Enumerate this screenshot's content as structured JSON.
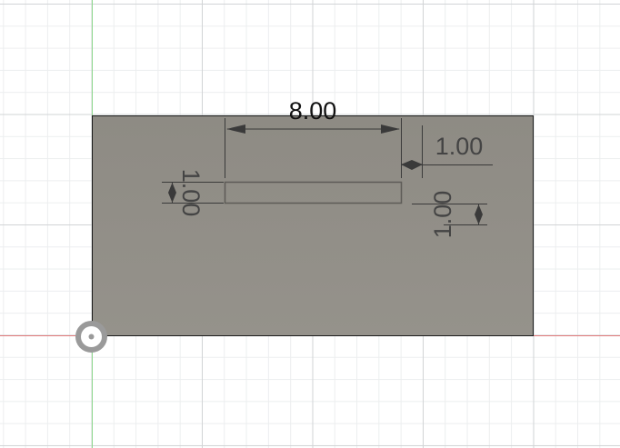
{
  "colors": {
    "canvas": "#ffffff",
    "x_axis": "#e07a7a",
    "y_axis": "#8fd88f",
    "body_top": "#8e8b84",
    "body_bottom": "#94918a",
    "dimension": "#3a3a3a"
  },
  "sketch": {
    "dimensions": {
      "slot_length": "8.00",
      "slot_offset_top": "1.00",
      "slot_height": "1.00",
      "slot_offset_right": "1.00"
    }
  },
  "icons": {
    "origin": "origin-icon"
  }
}
